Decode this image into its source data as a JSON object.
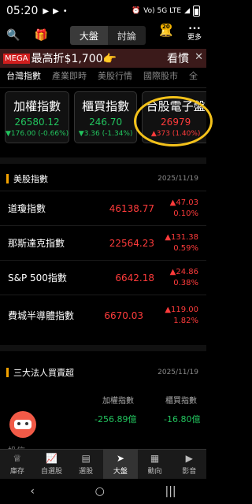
{
  "status": {
    "time": "05:20",
    "network": "Vo) 5G LTE"
  },
  "header": {
    "market_tab": "大盤",
    "forum_tab": "討論",
    "notif_badge": "20",
    "more_label": "更多"
  },
  "banner": {
    "mega": "MEGA",
    "text": "最高折$1,700👉",
    "right_text": "看慣",
    "close": "✕"
  },
  "tabs": [
    "台灣指數",
    "產業即時",
    "美股行情",
    "國際股市",
    "全"
  ],
  "cards": [
    {
      "name": "加權指數",
      "value": "26580.12",
      "change": "▼176.00 (-0.66%)",
      "dir": "down"
    },
    {
      "name": "櫃買指數",
      "value": "246.70",
      "change": "▼3.36 (-1.34%)",
      "dir": "down"
    },
    {
      "name": "台股電子盤",
      "value": "26979",
      "change": "▲373 (1.40%)",
      "dir": "up"
    }
  ],
  "us_section": {
    "title": "美股指數",
    "date": "2025/11/19"
  },
  "us_rows": [
    {
      "name": "道瓊指數",
      "price": "46138.77",
      "change": "▲47.03",
      "pct": "0.10%"
    },
    {
      "name": "那斯達克指數",
      "price": "22564.23",
      "change": "▲131.38",
      "pct": "0.59%"
    },
    {
      "name": "S&P 500指數",
      "price": "6642.18",
      "change": "▲24.86",
      "pct": "0.38%"
    },
    {
      "name": "費城半導體指數",
      "price": "6670.03",
      "change": "▲119.00",
      "pct": "1.82%"
    }
  ],
  "inst_section": {
    "title": "三大法人買賣超",
    "date": "2025/11/19"
  },
  "inst": {
    "col1": "加權指數",
    "col2": "櫃買指數",
    "val1": "-256.89億",
    "val2": "-16.80億",
    "peek": "投信"
  },
  "bottom_nav": [
    {
      "icon": "♕",
      "label": "庫存"
    },
    {
      "icon": "📈",
      "label": "自選股"
    },
    {
      "icon": "▤",
      "label": "選股"
    },
    {
      "icon": "➤",
      "label": "大盤"
    },
    {
      "icon": "▦",
      "label": "動向"
    },
    {
      "icon": "▶",
      "label": "影音"
    }
  ],
  "system_nav": {
    "back": "‹",
    "home": "○",
    "recent": "|||"
  }
}
